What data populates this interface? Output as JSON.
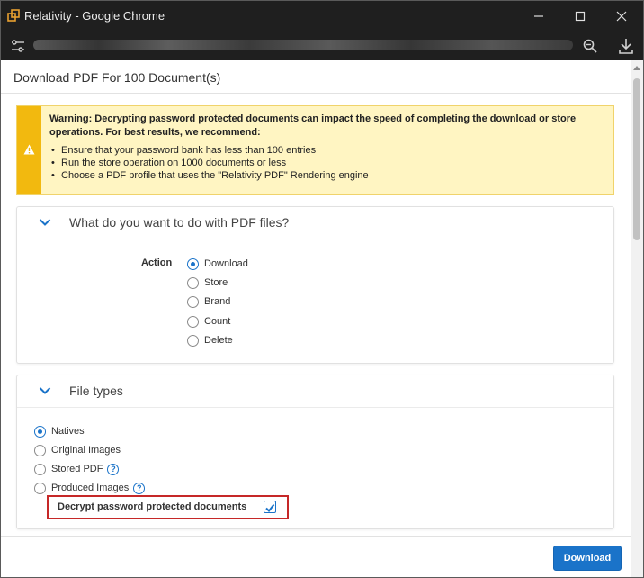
{
  "window": {
    "title": "Relativity - Google Chrome",
    "minimize_glyph": "—",
    "maximize_glyph": "☐",
    "close_glyph": "✕"
  },
  "dialog": {
    "title": "Download PDF For 100 Document(s)"
  },
  "warning": {
    "heading": "Warning: Decrypting password protected documents can impact the speed of completing the download or store operations. For best results, we recommend:",
    "items": [
      "Ensure that your password bank has less than 100 entries",
      "Run the store operation on 1000 documents or less",
      "Choose a PDF profile that uses the \"Relativity PDF\" Rendering engine"
    ],
    "icon": "warning-triangle-icon",
    "color": "#f2b90f"
  },
  "action_section": {
    "title": "What do you want to do with PDF files?",
    "label": "Action",
    "options": [
      "Download",
      "Store",
      "Brand",
      "Count",
      "Delete"
    ],
    "selected": "Download"
  },
  "file_types_section": {
    "title": "File types",
    "options": [
      "Natives",
      "Original Images",
      "Stored PDF",
      "Produced Images"
    ],
    "selected": "Natives",
    "help_glyph": "?",
    "decrypt_label": "Decrypt password protected documents",
    "decrypt_checked": true
  },
  "footer": {
    "download_label": "Download"
  },
  "colors": {
    "accent": "#1a73c9",
    "highlight_border": "#c62828",
    "warning_bg": "#fff5c2"
  }
}
